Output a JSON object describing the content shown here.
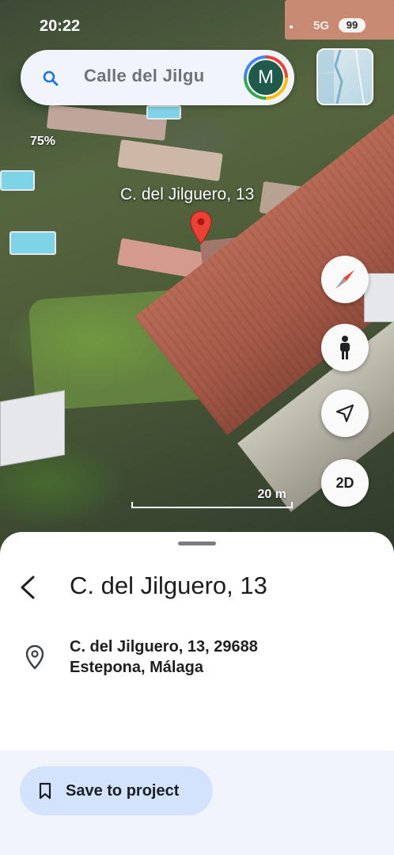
{
  "status_bar": {
    "time": "20:22",
    "network": "5G",
    "battery": "99"
  },
  "search": {
    "query": "Calle del Jilgu",
    "avatar_letter": "M"
  },
  "map": {
    "tilt": "75%",
    "place_label": "C. del Jilguero, 13",
    "scale_label": "20 m",
    "view_toggle_label": "2D",
    "pin_color": "#ea4335"
  },
  "sheet": {
    "title": "C. del Jilguero, 13",
    "address_line1": "C. del Jilguero, 13, 29688",
    "address_line2": "Estepona, Málaga",
    "save_label": "Save to project"
  },
  "icons": [
    "search-icon",
    "layers-icon",
    "compass-icon",
    "pegman-icon",
    "my-location-icon",
    "back-arrow-icon",
    "location-pin-icon",
    "bookmark-icon"
  ]
}
